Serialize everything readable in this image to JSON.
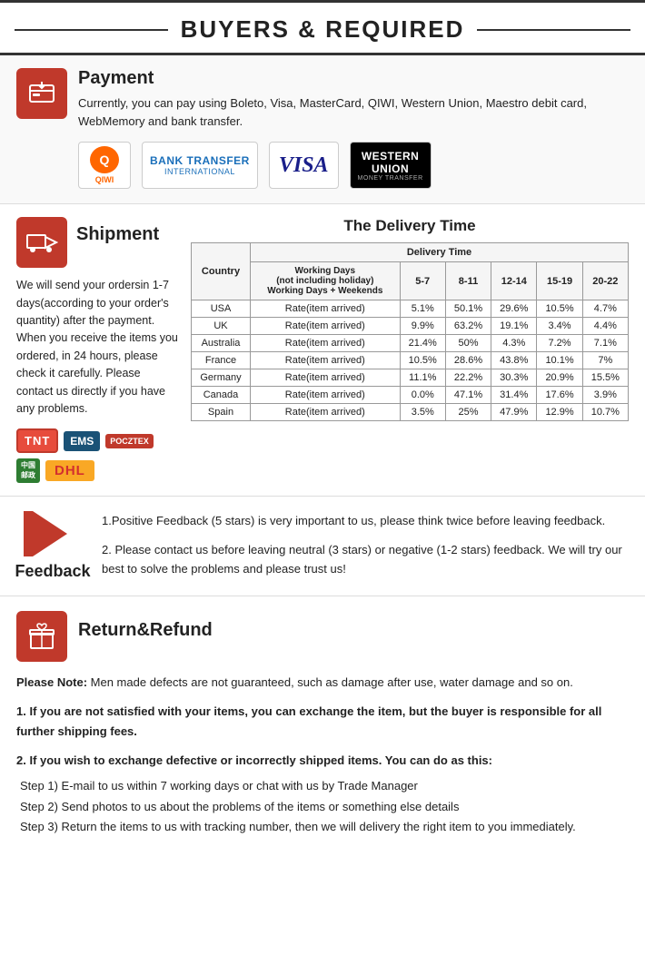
{
  "header": {
    "title": "BUYERS & REQUIRED"
  },
  "payment": {
    "section_title": "Payment",
    "description": "Currently, you can pay using Boleto, Visa, MasterCard, QIWI, Western Union, Maestro  debit card, WebMemory and bank transfer.",
    "logos": [
      {
        "name": "QIWI",
        "type": "qiwi"
      },
      {
        "name": "BANK TRANSFER INTERNATIONAL",
        "type": "bank"
      },
      {
        "name": "VISA",
        "type": "visa"
      },
      {
        "name": "WESTERN UNION MONEY TRANSFER",
        "type": "wu"
      }
    ]
  },
  "shipment": {
    "section_title": "Shipment",
    "delivery_title": "The Delivery Time",
    "body_text": "We will send your ordersin 1-7 days(according to your order's quantity) after the payment. When you receive the items you ordered, in 24  hours, please check it carefully. Please  contact us directly if you have any problems.",
    "table": {
      "headers": [
        "Country",
        "Delivery Time"
      ],
      "subheaders": [
        "Working Days\n(not including holiday)\nWorking Days + Weekends",
        "5-7",
        "8-11",
        "12-14",
        "15-19",
        "20-22"
      ],
      "rows": [
        {
          "country": "USA",
          "rate": "Rate(item arrived)",
          "v1": "5.1%",
          "v2": "50.1%",
          "v3": "29.6%",
          "v4": "10.5%",
          "v5": "4.7%"
        },
        {
          "country": "UK",
          "rate": "Rate(item arrived)",
          "v1": "9.9%",
          "v2": "63.2%",
          "v3": "19.1%",
          "v4": "3.4%",
          "v5": "4.4%"
        },
        {
          "country": "Australia",
          "rate": "Rate(item arrived)",
          "v1": "21.4%",
          "v2": "50%",
          "v3": "4.3%",
          "v4": "7.2%",
          "v5": "7.1%"
        },
        {
          "country": "France",
          "rate": "Rate(item arrived)",
          "v1": "10.5%",
          "v2": "28.6%",
          "v3": "43.8%",
          "v4": "10.1%",
          "v5": "7%"
        },
        {
          "country": "Germany",
          "rate": "Rate(item arrived)",
          "v1": "11.1%",
          "v2": "22.2%",
          "v3": "30.3%",
          "v4": "20.9%",
          "v5": "15.5%"
        },
        {
          "country": "Canada",
          "rate": "Rate(item arrived)",
          "v1": "0.0%",
          "v2": "47.1%",
          "v3": "31.4%",
          "v4": "17.6%",
          "v5": "3.9%"
        },
        {
          "country": "Spain",
          "rate": "Rate(item arrived)",
          "v1": "3.5%",
          "v2": "25%",
          "v3": "47.9%",
          "v4": "12.9%",
          "v5": "10.7%"
        }
      ]
    }
  },
  "feedback": {
    "section_title": "Feedback",
    "text1": "1.Positive Feedback (5 stars) is very important to us, please think twice before leaving feedback.",
    "text2": "2. Please contact us before leaving neutral (3 stars) or negative  (1-2 stars) feedback. We will try our best to solve the problems and please trust us!"
  },
  "return_refund": {
    "section_title": "Return&Refund",
    "note": "Please Note:",
    "note_text": " Men made defects are not guaranteed, such as damage after use, water damage and so on.",
    "point1": "1. If you are not satisfied with your items, you can exchange the item, but the buyer is responsible for all further shipping fees.",
    "point2": "2. If you wish to exchange defective or incorrectly shipped items. You can do as this:",
    "step1": "Step 1) E-mail to us within 7 working days or chat with us by Trade Manager",
    "step2": "Step 2) Send photos to us about the problems of the items or something else details",
    "step3": "Step 3) Return the items to us with tracking number, then we will delivery the right item to you immediately."
  }
}
